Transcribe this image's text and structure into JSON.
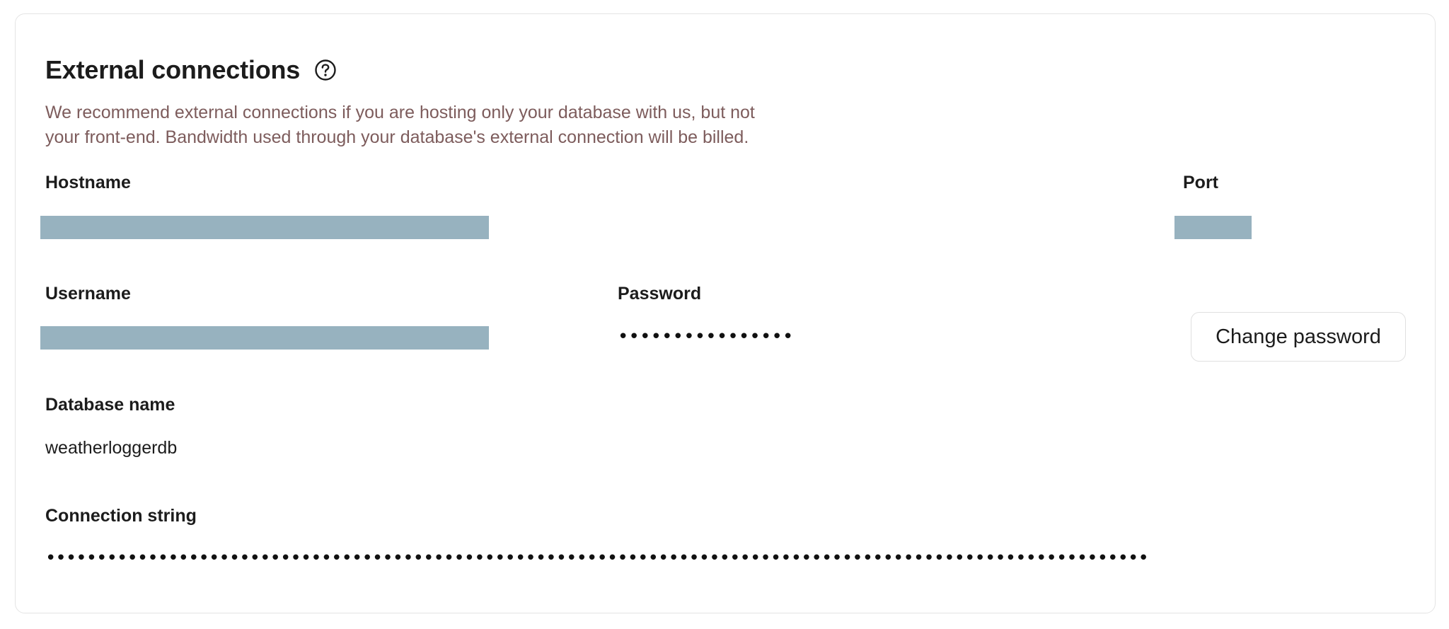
{
  "section": {
    "title": "External connections",
    "help_icon": "question-circle-icon",
    "description_line1": "We recommend external connections if you are hosting only your database with us, but not",
    "description_line2": "your front-end. Bandwidth used through your database's external connection will be billed."
  },
  "fields": {
    "hostname_label": "Hostname",
    "port_label": "Port",
    "username_label": "Username",
    "password_label": "Password",
    "password_value": "••••••••••••••••",
    "database_name_label": "Database name",
    "database_name_value": "weatherloggerdb",
    "connection_string_label": "Connection string",
    "connection_string_value": "••••••••••••••••••••••••••••••••••••••••••••••••••••••••••••••••••••••••••••••••••••••••••••••••••••••••••••"
  },
  "actions": {
    "change_password_label": "Change password"
  },
  "colors": {
    "redacted": "#97b2bf",
    "description_text": "#7d5c5c",
    "border": "#e4e4e4"
  }
}
